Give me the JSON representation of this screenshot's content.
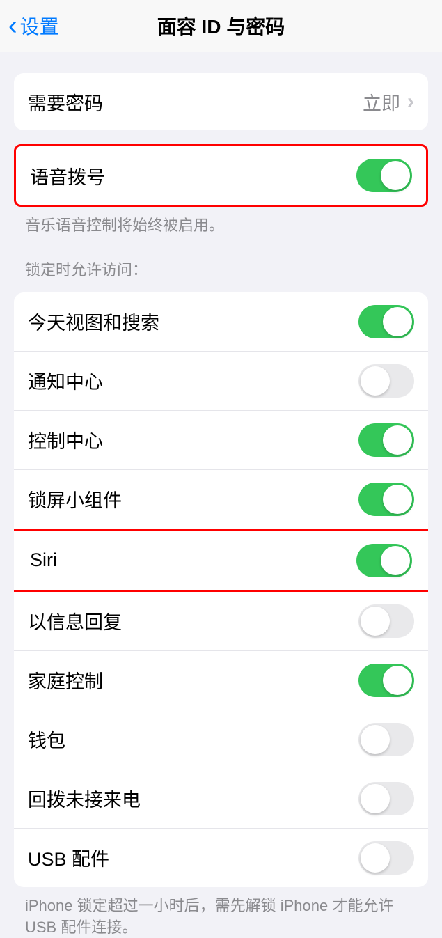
{
  "header": {
    "back_label": "设置",
    "title": "面容 ID 与密码"
  },
  "require_passcode": {
    "label": "需要密码",
    "value": "立即"
  },
  "voice_dial": {
    "label": "语音拨号",
    "on": true,
    "footer": "音乐语音控制将始终被启用。"
  },
  "lock_access": {
    "header": "锁定时允许访问：",
    "items": [
      {
        "label": "今天视图和搜索",
        "on": true
      },
      {
        "label": "通知中心",
        "on": false
      },
      {
        "label": "控制中心",
        "on": true
      },
      {
        "label": "锁屏小组件",
        "on": true
      },
      {
        "label": "Siri",
        "on": true,
        "highlight": true
      },
      {
        "label": "以信息回复",
        "on": false
      },
      {
        "label": "家庭控制",
        "on": true
      },
      {
        "label": "钱包",
        "on": false
      },
      {
        "label": "回拨未接来电",
        "on": false
      },
      {
        "label": "USB 配件",
        "on": false
      }
    ],
    "footer": "iPhone 锁定超过一小时后，需先解锁 iPhone 才能允许 USB 配件连接。"
  }
}
